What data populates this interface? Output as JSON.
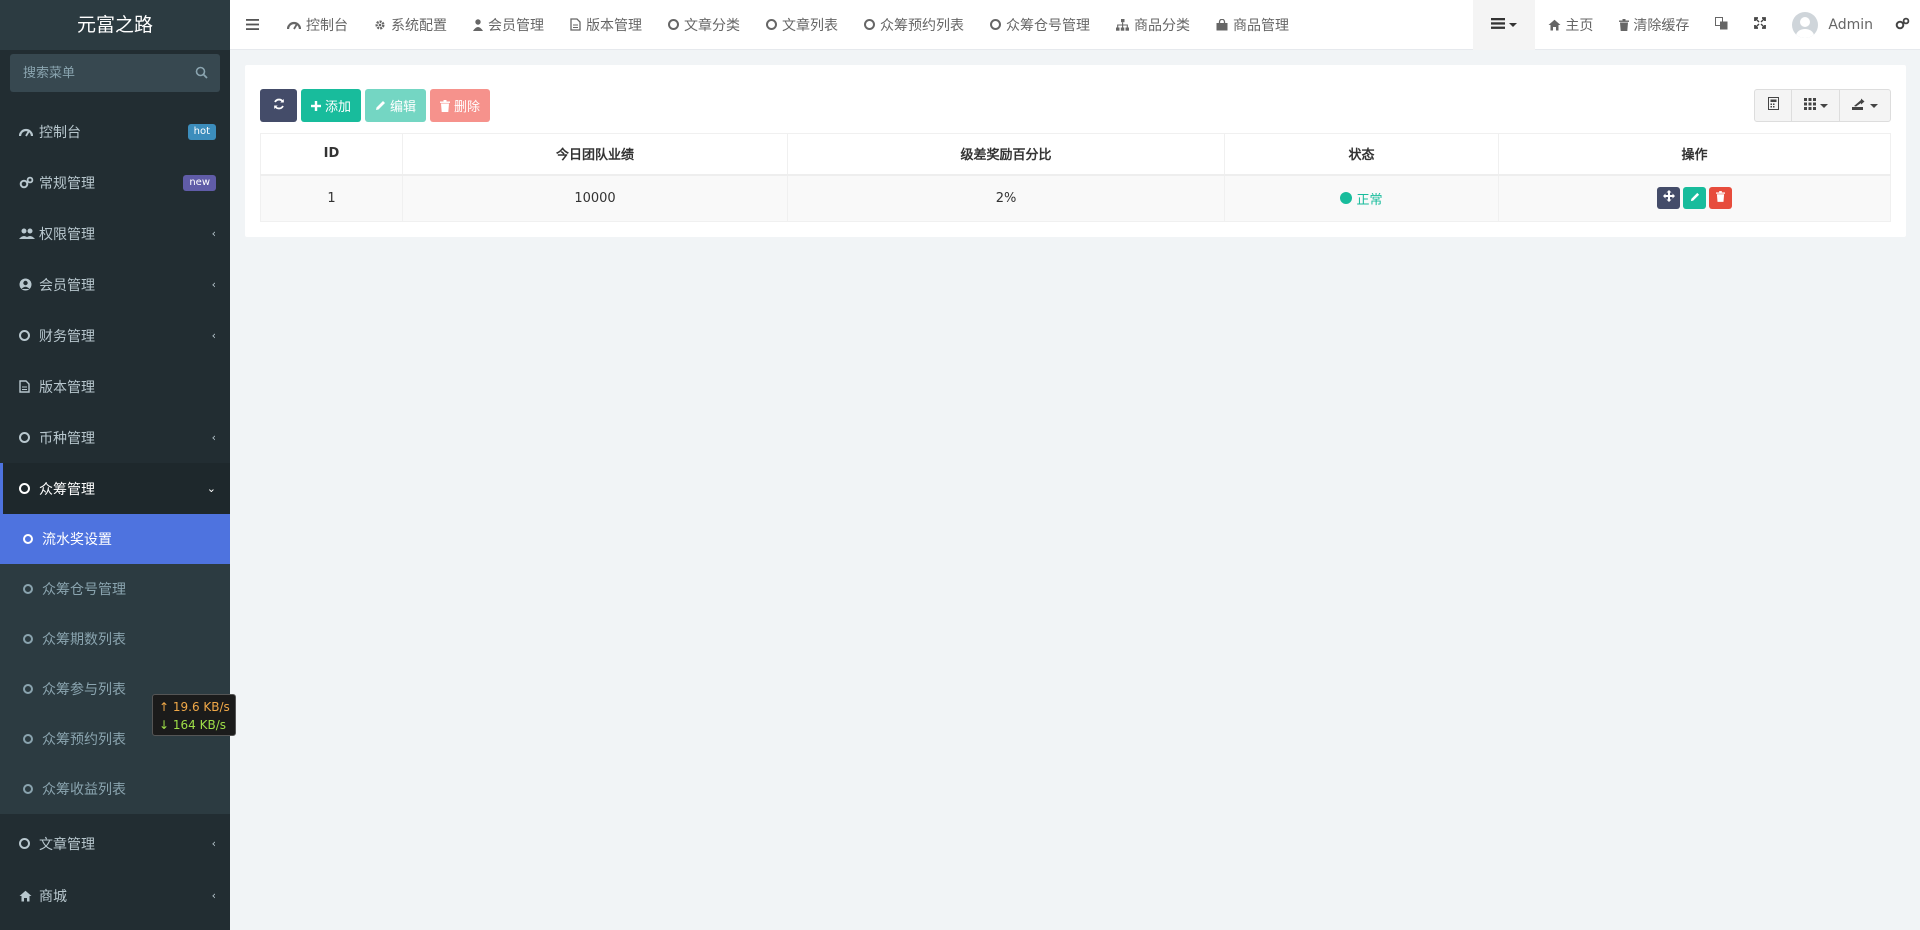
{
  "brand": {
    "title": "元富之路"
  },
  "search": {
    "placeholder": "搜索菜单"
  },
  "sidebar": {
    "items": [
      {
        "label": "控制台",
        "badge": "hot",
        "badge_color": "#3c8dbc"
      },
      {
        "label": "常规管理",
        "badge": "new",
        "badge_color": "#605ca8"
      },
      {
        "label": "权限管理",
        "chevron": "‹"
      },
      {
        "label": "会员管理",
        "chevron": "‹"
      },
      {
        "label": "财务管理",
        "chevron": "‹"
      },
      {
        "label": "版本管理"
      },
      {
        "label": "币种管理",
        "chevron": "‹"
      },
      {
        "label": "众筹管理",
        "chevron": "⌄"
      }
    ],
    "submenu": [
      {
        "label": "流水奖设置"
      },
      {
        "label": "众筹仓号管理"
      },
      {
        "label": "众筹期数列表"
      },
      {
        "label": "众筹参与列表"
      },
      {
        "label": "众筹预约列表"
      },
      {
        "label": "众筹收益列表"
      }
    ],
    "after": [
      {
        "label": "文章管理",
        "chevron": "‹"
      },
      {
        "label": "商城",
        "chevron": "‹"
      }
    ]
  },
  "topnav": {
    "tabs": [
      {
        "label": "控制台",
        "icon": "dashboard-icon"
      },
      {
        "label": "系统配置",
        "icon": "gear-icon"
      },
      {
        "label": "会员管理",
        "icon": "user-icon"
      },
      {
        "label": "版本管理",
        "icon": "file-icon"
      },
      {
        "label": "文章分类",
        "icon": "circle-icon"
      },
      {
        "label": "文章列表",
        "icon": "circle-icon"
      },
      {
        "label": "众筹预约列表",
        "icon": "circle-icon"
      },
      {
        "label": "众筹仓号管理",
        "icon": "circle-icon"
      },
      {
        "label": "商品分类",
        "icon": "sitemap-icon"
      },
      {
        "label": "商品管理",
        "icon": "bag-icon"
      }
    ],
    "home": "主页",
    "clear_cache": "清除缓存",
    "username": "Admin"
  },
  "toolbar": {
    "add": "添加",
    "edit": "编辑",
    "delete": "删除"
  },
  "table": {
    "columns": [
      "ID",
      "今日团队业绩",
      "级差奖励百分比",
      "状态",
      "操作"
    ],
    "rows": [
      {
        "id": "1",
        "performance": "10000",
        "percent": "2%",
        "status": "正常"
      }
    ]
  },
  "network": {
    "up": "↑ 19.6 KB/s",
    "down": "↓ 164 KB/s"
  },
  "colors": {
    "sidebar_bg": "#222d32",
    "active": "#4e73df",
    "success": "#18bc9c",
    "danger": "#e74c3c",
    "dark": "#444c69"
  }
}
